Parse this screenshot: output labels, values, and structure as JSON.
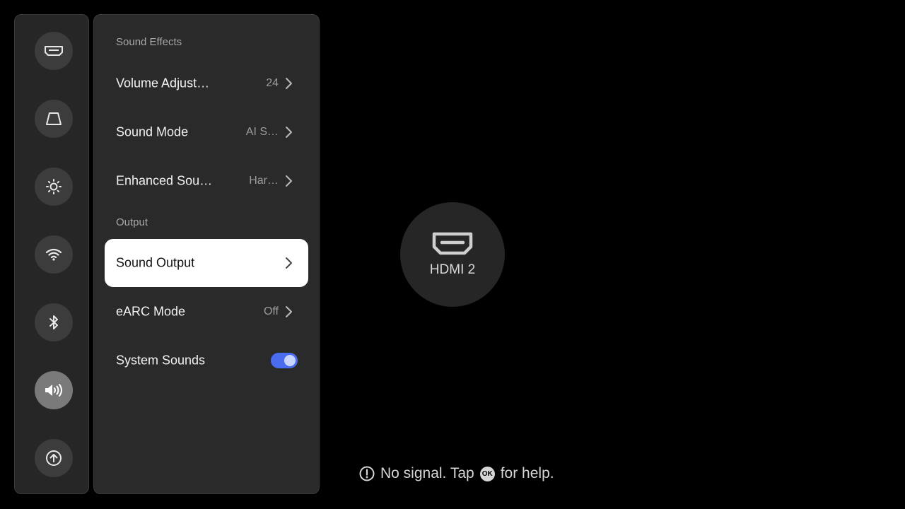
{
  "rail": {
    "items": [
      {
        "icon": "hdmi-input-icon",
        "active": false
      },
      {
        "icon": "keystone-icon",
        "active": false
      },
      {
        "icon": "brightness-icon",
        "active": false
      },
      {
        "icon": "wifi-icon",
        "active": false
      },
      {
        "icon": "bluetooth-icon",
        "active": false
      },
      {
        "icon": "volume-icon",
        "active": true
      },
      {
        "icon": "upload-icon",
        "active": false
      }
    ]
  },
  "panel": {
    "sections": {
      "sound_effects": "Sound Effects",
      "output": "Output"
    },
    "rows": {
      "volume": {
        "label": "Volume Adjust…",
        "value": "24"
      },
      "sound_mode": {
        "label": "Sound Mode",
        "value": "AI S…"
      },
      "enhanced": {
        "label": "Enhanced Sou…",
        "value": "Har…"
      },
      "sound_output": {
        "label": "Sound Output",
        "selected": true
      },
      "earc": {
        "label": "eARC Mode",
        "value": "Off"
      },
      "system_sounds": {
        "label": "System Sounds",
        "enabled": true
      }
    }
  },
  "source": {
    "label": "HDMI 2",
    "icon": "hdmi-icon"
  },
  "help": {
    "before": "No signal. Tap",
    "badge": "OK",
    "after": "for help."
  },
  "colors": {
    "accent": "#4a6cf0",
    "selected_row": "#ffffff",
    "panel_bg": "#2a2a2a"
  }
}
